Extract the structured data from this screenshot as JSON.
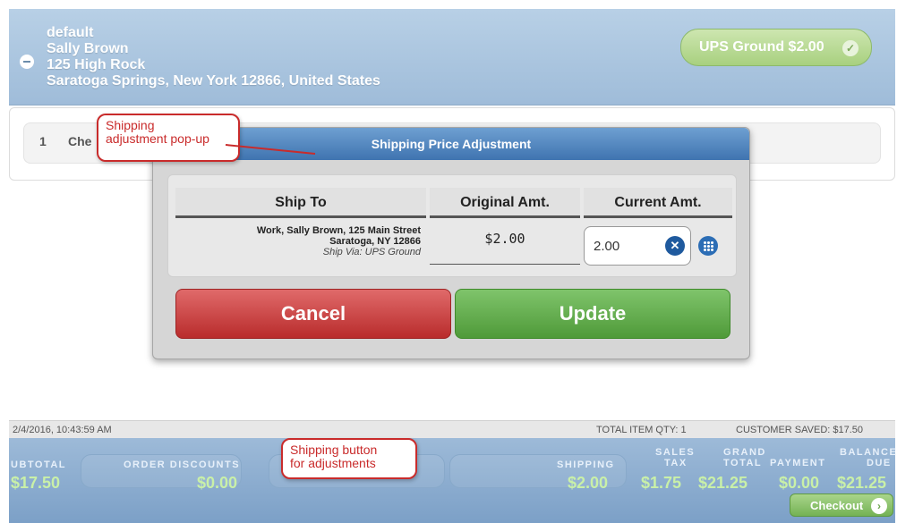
{
  "header": {
    "address_lines": [
      "default",
      "Sally Brown",
      "125 High Rock",
      "Saratoga Springs, New York 12866, United States"
    ],
    "shipping_method_label": "UPS Ground $2.00"
  },
  "order": {
    "line_number": "1",
    "line_label_visible": "Che"
  },
  "modal": {
    "title": "Shipping Price Adjustment",
    "columns": [
      "Ship To",
      "Original Amt.",
      "Current Amt."
    ],
    "row": {
      "ship_to_line1": "Work, Sally Brown, 125 Main Street",
      "ship_to_line2": "Saratoga, NY 12866",
      "ship_via": "Ship Via: UPS Ground",
      "original_amount": "$2.00",
      "current_amount": "2.00"
    },
    "cancel_label": "Cancel",
    "update_label": "Update"
  },
  "callouts": {
    "popup_line1": "Shipping",
    "popup_line2": "adjustment pop-up",
    "button_line1": "Shipping button",
    "button_line2": "for adjustments"
  },
  "status": {
    "timestamp": "2/4/2016, 10:43:59 AM",
    "total_item_qty": "TOTAL ITEM QTY:  1",
    "customer_saved": "CUSTOMER SAVED:  $17.50"
  },
  "totals": {
    "subtotal_label": "UBTOTAL",
    "subtotal_value": "$17.50",
    "order_discounts_label": "ORDER DISCOUNTS",
    "order_discounts_value": "$0.00",
    "shipping_label": "SHIPPING",
    "shipping_value": "$2.00",
    "sales_tax_label_1": "SALES",
    "sales_tax_label_2": "TAX",
    "sales_tax_value": "$1.75",
    "grand_total_label_1": "GRAND",
    "grand_total_label_2": "TOTAL",
    "grand_total_value": "$21.25",
    "payment_label": "PAYMENT",
    "payment_value": "$0.00",
    "balance_label_1": "BALANCE",
    "balance_label_2": "DUE",
    "balance_value": "$21.25",
    "checkout_label": "Checkout"
  },
  "icons": {
    "collapse": "minus-circle-icon",
    "check": "check-circle-icon",
    "clear": "x-circle-icon",
    "keypad": "keypad-icon",
    "arrow": "chevron-right-circle-icon"
  },
  "colors": {
    "header_blue": "#a7c2dd",
    "modal_title_blue": "#3f74b0",
    "cancel_red": "#c23a3a",
    "update_green": "#5aa844",
    "callout_red": "#c92b2b",
    "totals_value_green": "#c9f0a8"
  }
}
